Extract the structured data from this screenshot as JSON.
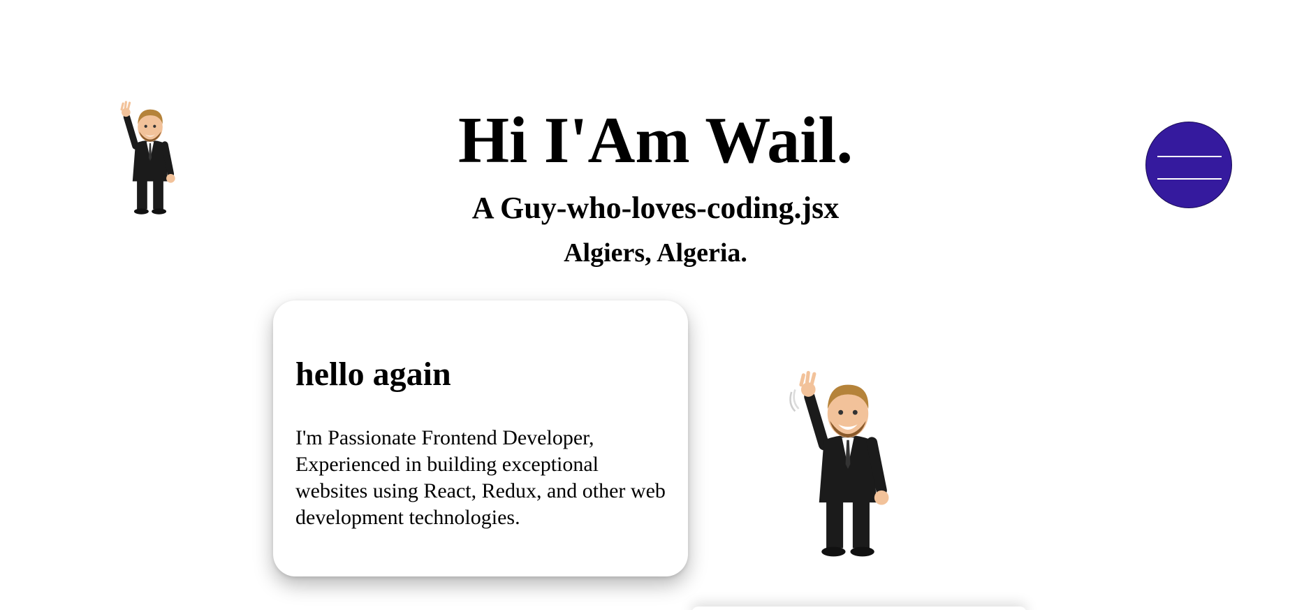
{
  "hero": {
    "title": "Hi I'Am Wail.",
    "subtitle": "A Guy-who-loves-coding.jsx",
    "location": "Algiers, Algeria."
  },
  "menu": {
    "icon": "hamburger-menu-icon",
    "color": "#351a9e"
  },
  "about_card": {
    "heading": "hello again",
    "text": "I'm Passionate Frontend Developer, Experienced in building exceptional websites using React, Redux, and other web development technologies."
  },
  "avatars": [
    {
      "icon": "waving-man-avatar"
    },
    {
      "icon": "waving-man-avatar"
    }
  ]
}
